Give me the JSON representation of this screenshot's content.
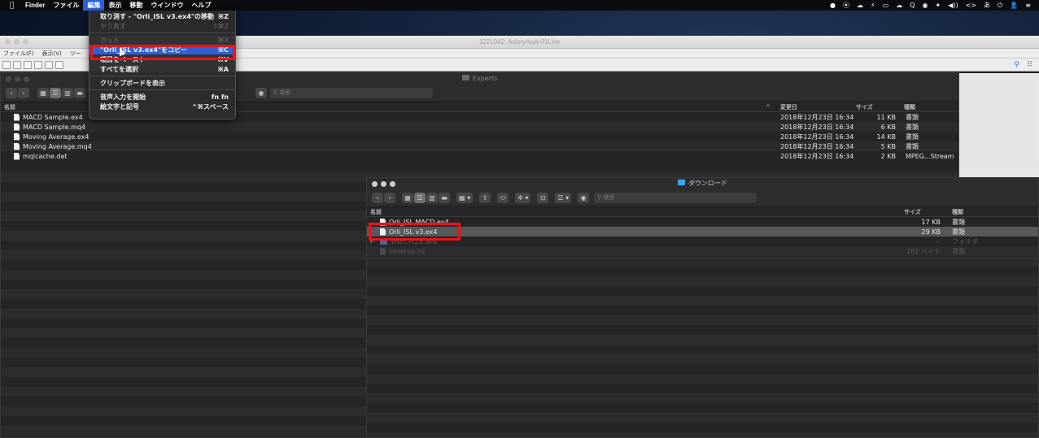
{
  "menubar": {
    "apple": "",
    "app": "Finder",
    "items": [
      "ファイル",
      "編集",
      "表示",
      "移動",
      "ウインドウ",
      "ヘルプ"
    ],
    "status_icons": [
      "●",
      "⦿",
      "☁",
      "⚡",
      "▭",
      "☁",
      "Q",
      "◉",
      "✦",
      "◀))",
      "<>",
      "あ",
      "⏻",
      "👤",
      "≡"
    ]
  },
  "mt4": {
    "title": "1221042: AxioryAsia-01Live",
    "menu": [
      "ファイル(F)",
      "表示(V)",
      "ツー"
    ]
  },
  "experts": {
    "title": "Experts",
    "search_placeholder": "検索",
    "columns": {
      "name": "名前",
      "date": "変更日",
      "size": "サイズ",
      "kind": "種類"
    },
    "files": [
      {
        "name": "MACD Sample.ex4",
        "date": "2018年12月23日 16:34",
        "size": "11 KB",
        "kind": "書類"
      },
      {
        "name": "MACD Sample.mq4",
        "date": "2018年12月23日 16:34",
        "size": "6 KB",
        "kind": "書類"
      },
      {
        "name": "Moving Average.ex4",
        "date": "2018年12月23日 16:34",
        "size": "14 KB",
        "kind": "書類"
      },
      {
        "name": "Moving Average.mq4",
        "date": "2018年12月23日 16:34",
        "size": "5 KB",
        "kind": "書類"
      },
      {
        "name": "mqlcache.dat",
        "date": "2018年12月23日 16:34",
        "size": "2 KB",
        "kind": "MPEG...Stream"
      }
    ]
  },
  "downloads": {
    "title": "ダウンロード",
    "search_placeholder": "検索",
    "columns": {
      "name": "名前",
      "size": "サイズ",
      "kind": "種類"
    },
    "files": [
      {
        "name": "Orli_ISL MACD.ex4",
        "size": "17 KB",
        "kind": "書類"
      },
      {
        "name": "Orli_ISL v3.ex4",
        "size": "29 KB",
        "kind": "書類"
      },
      {
        "name": "$RECYCLE.BIN",
        "size": "--",
        "kind": "フォルダ"
      },
      {
        "name": "desktop.ini",
        "size": "282 バイト",
        "kind": "書類"
      }
    ]
  },
  "edit_menu": {
    "undo": {
      "label": "取り消す - \"Orli_ISL v3.ex4\"の移動",
      "shortcut": "⌘Z"
    },
    "redo": {
      "label": "やり直す",
      "shortcut": "⇧⌘Z"
    },
    "cut": {
      "label": "カット",
      "shortcut": "⌘X"
    },
    "copy": {
      "label": "\"Orli_ISL v3.ex4\"をコピー",
      "shortcut": "⌘C"
    },
    "paste": {
      "label": "項目をペースト",
      "shortcut": "⌘V"
    },
    "select_all": {
      "label": "すべてを選択",
      "shortcut": "⌘A"
    },
    "show_clipboard": {
      "label": "クリップボードを表示",
      "shortcut": ""
    },
    "dictation": {
      "label": "音声入力を開始",
      "shortcut": "fn fn"
    },
    "emoji": {
      "label": "絵文字と記号",
      "shortcut": "^⌘スペース"
    }
  }
}
